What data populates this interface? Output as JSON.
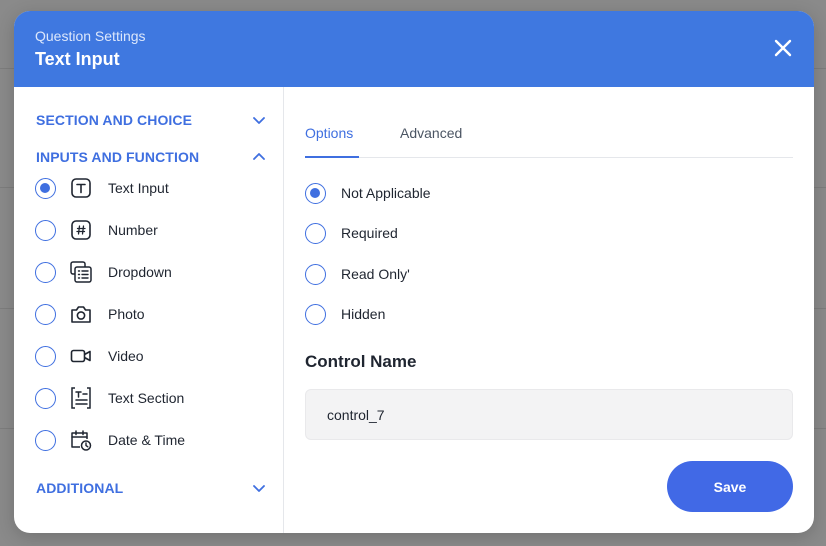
{
  "header": {
    "subtitle": "Question Settings",
    "title": "Text Input",
    "close_icon": "close-icon"
  },
  "sidebar": {
    "sections": [
      {
        "label": "SECTION AND CHOICE",
        "expanded": false
      },
      {
        "label": "INPUTS AND FUNCTION",
        "expanded": true
      },
      {
        "label": "ADDITIONAL",
        "expanded": false
      }
    ],
    "items": [
      {
        "label": "Text Input",
        "icon": "text-input-icon",
        "selected": true
      },
      {
        "label": "Number",
        "icon": "number-icon",
        "selected": false
      },
      {
        "label": "Dropdown",
        "icon": "dropdown-icon",
        "selected": false
      },
      {
        "label": "Photo",
        "icon": "camera-icon",
        "selected": false
      },
      {
        "label": "Video",
        "icon": "video-icon",
        "selected": false
      },
      {
        "label": "Text Section",
        "icon": "text-section-icon",
        "selected": false
      },
      {
        "label": "Date & Time",
        "icon": "calendar-clock-icon",
        "selected": false
      }
    ]
  },
  "tabs": [
    {
      "label": "Options",
      "active": true
    },
    {
      "label": "Advanced",
      "active": false
    }
  ],
  "requirement_options": [
    {
      "label": "Not Applicable",
      "selected": true
    },
    {
      "label": "Required",
      "selected": false
    },
    {
      "label": "Read Only'",
      "selected": false
    },
    {
      "label": "Hidden",
      "selected": false
    }
  ],
  "control": {
    "label": "Control Name",
    "value": "control_7"
  },
  "save_label": "Save",
  "colors": {
    "header_bg": "#3f78e0",
    "accent": "#3f6fe0",
    "save_button": "#4169e6"
  }
}
